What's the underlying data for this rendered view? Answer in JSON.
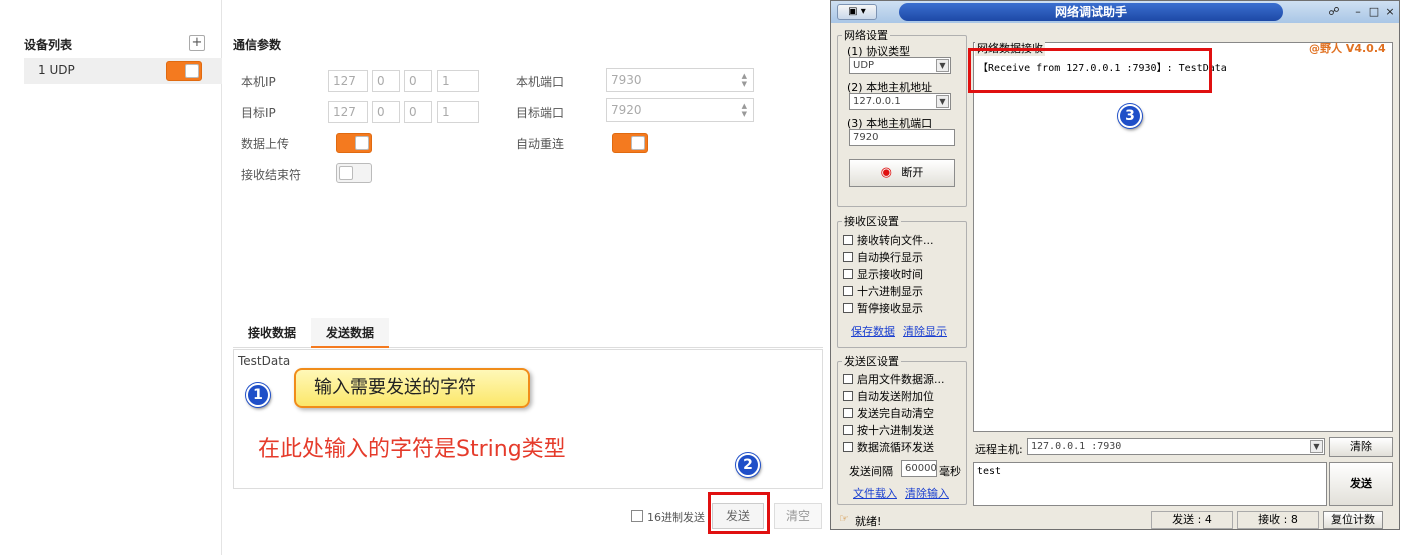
{
  "left": {
    "device_list_title": "设备列表",
    "add_icon": "+",
    "device_item": "1 UDP",
    "comm_params_title": "通信参数",
    "local_ip_label": "本机IP",
    "local_ip": [
      "127",
      "0",
      "0",
      "1"
    ],
    "target_ip_label": "目标IP",
    "target_ip": [
      "127",
      "0",
      "0",
      "1"
    ],
    "local_port_label": "本机端口",
    "local_port": "7930",
    "target_port_label": "目标端口",
    "target_port": "7920",
    "data_upload_label": "数据上传",
    "data_upload_on": true,
    "auto_reconnect_label": "自动重连",
    "auto_reconnect_on": true,
    "recv_terminator_label": "接收结束符",
    "recv_terminator_on": false,
    "tab_receive": "接收数据",
    "tab_send": "发送数据",
    "send_text": "TestData",
    "hex_send_label": "16进制发送",
    "send_button": "发送",
    "clear_button": "清空"
  },
  "annotations": {
    "n1": "1",
    "n2": "2",
    "n3": "3",
    "bubble_text": "输入需要发送的字符",
    "red_note": "在此处输入的字符是String类型"
  },
  "net_tool": {
    "title": "网络调试助手",
    "net_settings": "网络设置",
    "protocol_label": "(1) 协议类型",
    "protocol": "UDP",
    "host_addr_label": "(2) 本地主机地址",
    "host_addr": "127.0.0.1",
    "host_port_label": "(3) 本地主机端口",
    "host_port": "7920",
    "disconnect_button": "断开",
    "recv_settings": "接收区设置",
    "recv_options": [
      "接收转向文件...",
      "自动换行显示",
      "显示接收时间",
      "十六进制显示",
      "暂停接收显示"
    ],
    "save_data": "保存数据",
    "clear_display": "清除显示",
    "send_settings": "发送区设置",
    "send_options": [
      "启用文件数据源...",
      "自动发送附加位",
      "发送完自动清空",
      "按十六进制发送",
      "数据流循环发送"
    ],
    "send_interval_label": "发送间隔",
    "send_interval": "60000",
    "send_interval_unit": "毫秒",
    "file_load": "文件载入",
    "clear_input": "清除输入",
    "recv_area_title": "网络数据接收",
    "version": "@野人 V4.0.4",
    "received_text": "【Receive from 127.0.0.1 :7930】: TestData",
    "remote_host_label": "远程主机:",
    "remote_host": "127.0.0.1 :7930",
    "clear_button": "清除",
    "send_input": "test",
    "send_button": "发送",
    "status_ready": "就绪!",
    "sent_count": "发送 : 4",
    "recv_count": "接收 : 8",
    "reset_count": "复位计数"
  }
}
